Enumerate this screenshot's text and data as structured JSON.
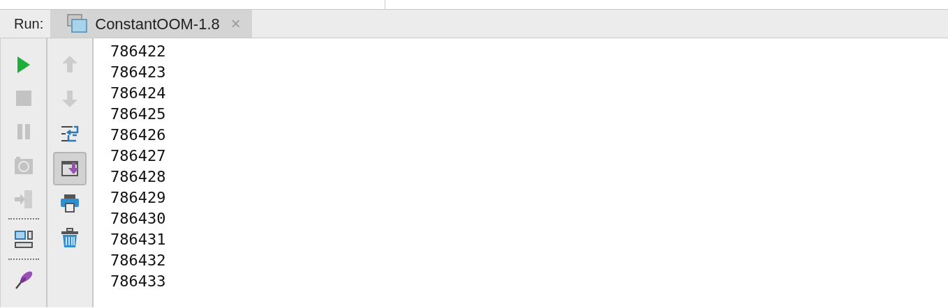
{
  "run_label": "Run:",
  "tabs": [
    {
      "label": "ConstantOOM-1.8",
      "selected": true,
      "close": "×"
    }
  ],
  "run_toolbar": [
    {
      "kind": "run",
      "disabled": false
    },
    {
      "kind": "stop",
      "disabled": true
    },
    {
      "kind": "pause",
      "disabled": true
    },
    {
      "kind": "camera",
      "disabled": true
    },
    {
      "kind": "exit",
      "disabled": true
    },
    {
      "kind": "separator"
    },
    {
      "kind": "layout",
      "disabled": false
    },
    {
      "kind": "separator"
    },
    {
      "kind": "pin",
      "disabled": false
    }
  ],
  "console_toolbar": [
    {
      "kind": "up",
      "disabled": true,
      "selected": false
    },
    {
      "kind": "down",
      "disabled": true,
      "selected": false
    },
    {
      "kind": "wrap",
      "disabled": false,
      "selected": false
    },
    {
      "kind": "scroll_end",
      "disabled": false,
      "selected": true
    },
    {
      "kind": "print",
      "disabled": false,
      "selected": false
    },
    {
      "kind": "trash",
      "disabled": false,
      "selected": false
    }
  ],
  "console_lines": [
    "786422",
    "786423",
    "786424",
    "786425",
    "786426",
    "786427",
    "786428",
    "786429",
    "786430",
    "786431",
    "786432",
    "786433"
  ]
}
